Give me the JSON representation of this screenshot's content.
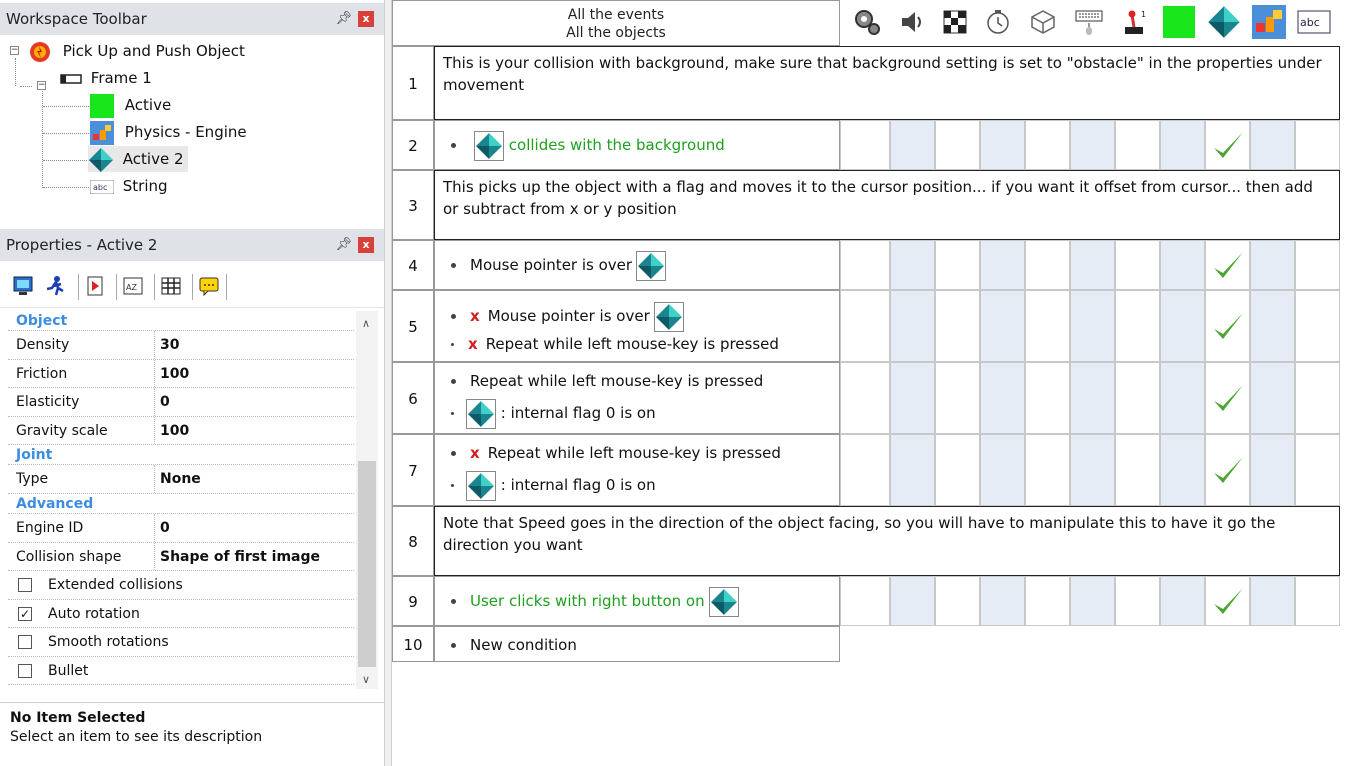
{
  "workspace": {
    "title": "Workspace Toolbar",
    "pin": "ᵠ",
    "close": "x",
    "tree": [
      {
        "label": "Pick Up and Push Object"
      },
      {
        "label": "Frame 1"
      },
      {
        "label": "Active"
      },
      {
        "label": "Physics - Engine"
      },
      {
        "label": "Active 2"
      },
      {
        "label": "String"
      }
    ]
  },
  "properties": {
    "title": "Properties - Active 2",
    "sections": {
      "object": "Object",
      "joint": "Joint",
      "advanced": "Advanced"
    },
    "rows": {
      "density": {
        "k": "Density",
        "v": "30"
      },
      "friction": {
        "k": "Friction",
        "v": "100"
      },
      "elasticity": {
        "k": "Elasticity",
        "v": "0"
      },
      "gravity": {
        "k": "Gravity scale",
        "v": "100"
      },
      "type": {
        "k": "Type",
        "v": "None"
      },
      "engine": {
        "k": "Engine ID",
        "v": "0"
      },
      "collision": {
        "k": "Collision shape",
        "v": "Shape of first image"
      }
    },
    "checkboxes": {
      "extended": {
        "label": "Extended collisions",
        "checked": false
      },
      "auto": {
        "label": "Auto rotation",
        "checked": true,
        "mark": "✓"
      },
      "smooth": {
        "label": "Smooth rotations",
        "checked": false
      },
      "bullet": {
        "label": "Bullet",
        "checked": false
      }
    },
    "description": {
      "title": "No Item Selected",
      "text": "Select an item to see its description"
    }
  },
  "editor": {
    "header": {
      "line1": "All the events",
      "line2": "All the objects"
    },
    "header_icon_names": [
      "special-conditions-icon",
      "sound-icon",
      "storyboard-icon",
      "timer-icon",
      "create-object-icon",
      "keyboard-mouse-icon",
      "player-icon",
      "active-object-icon",
      "active2-object-icon",
      "physics-engine-icon",
      "string-object-icon"
    ],
    "rows": {
      "r1": {
        "n": "1",
        "text": "This is your collision with background, make sure that background setting is set to \"obstacle\" in the properties under movement"
      },
      "r2": {
        "n": "2",
        "text": "collides with the background"
      },
      "r3": {
        "n": "3",
        "text": "This picks up the object with a flag and moves it to the cursor position... if you want it offset from cursor... then add or subtract from x or y position"
      },
      "r4": {
        "n": "4",
        "text": "Mouse pointer is over"
      },
      "r5": {
        "n": "5",
        "c1": "Mouse pointer is over",
        "c2": "Repeat while left mouse-key is pressed",
        "x": "x"
      },
      "r6": {
        "n": "6",
        "c1": "Repeat while left mouse-key is pressed",
        "c2": ": internal flag 0 is on"
      },
      "r7": {
        "n": "7",
        "c1": "Repeat while left mouse-key is pressed",
        "c2": ": internal flag 0 is on",
        "x": "x"
      },
      "r8": {
        "n": "8",
        "text": "Note that Speed goes in the direction of the object facing, so you will have to manipulate this to have it go the direction you want"
      },
      "r9": {
        "n": "9",
        "text": "User clicks with right button on"
      },
      "r10": {
        "n": "10",
        "text": "New condition"
      }
    },
    "colors": {
      "grid_shade": "#e6ecf6",
      "check": "#4aa62e",
      "green_text": "#1fa01f"
    }
  }
}
